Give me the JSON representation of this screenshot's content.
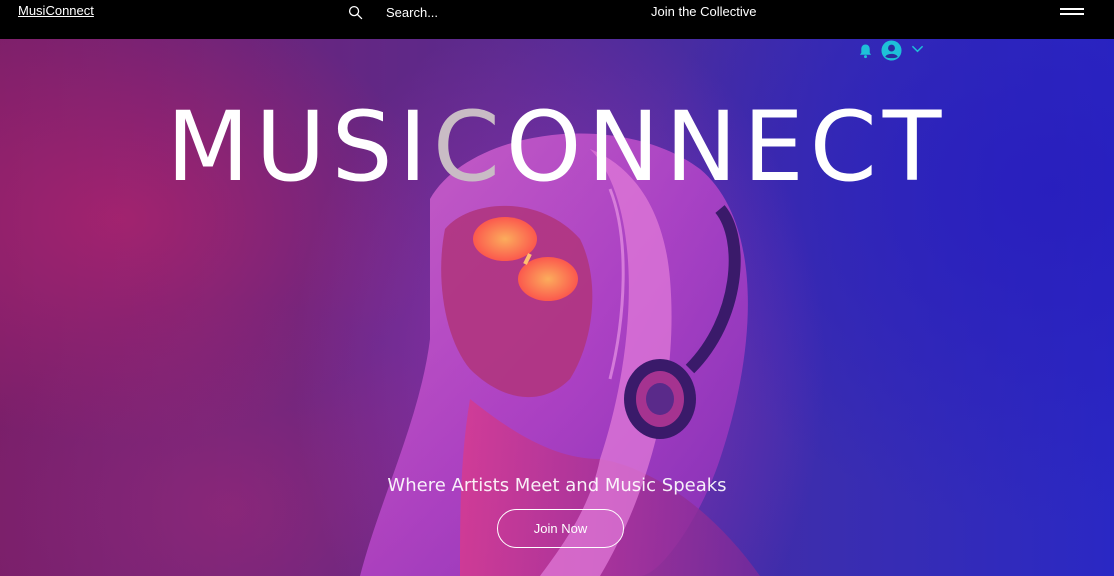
{
  "header": {
    "brand": "MusiConnect",
    "search": {
      "placeholder": "Search...",
      "value": ""
    },
    "join_link": "Join the Collective",
    "menu_icon": "hamburger-menu-icon"
  },
  "account": {
    "notification_icon": "bell-icon",
    "avatar_icon": "user-avatar-icon",
    "dropdown_icon": "chevron-down-icon"
  },
  "hero": {
    "title_part1": "MUSI",
    "title_part2": "C",
    "title_part3": "ONNECT",
    "tagline": "Where Artists Meet and Music Speaks",
    "cta_label": "Join Now"
  },
  "colors": {
    "header_bg": "#000000",
    "accent": "#1ec0d8",
    "hero_left": "#7a1f6a",
    "hero_right": "#2a28c4"
  }
}
